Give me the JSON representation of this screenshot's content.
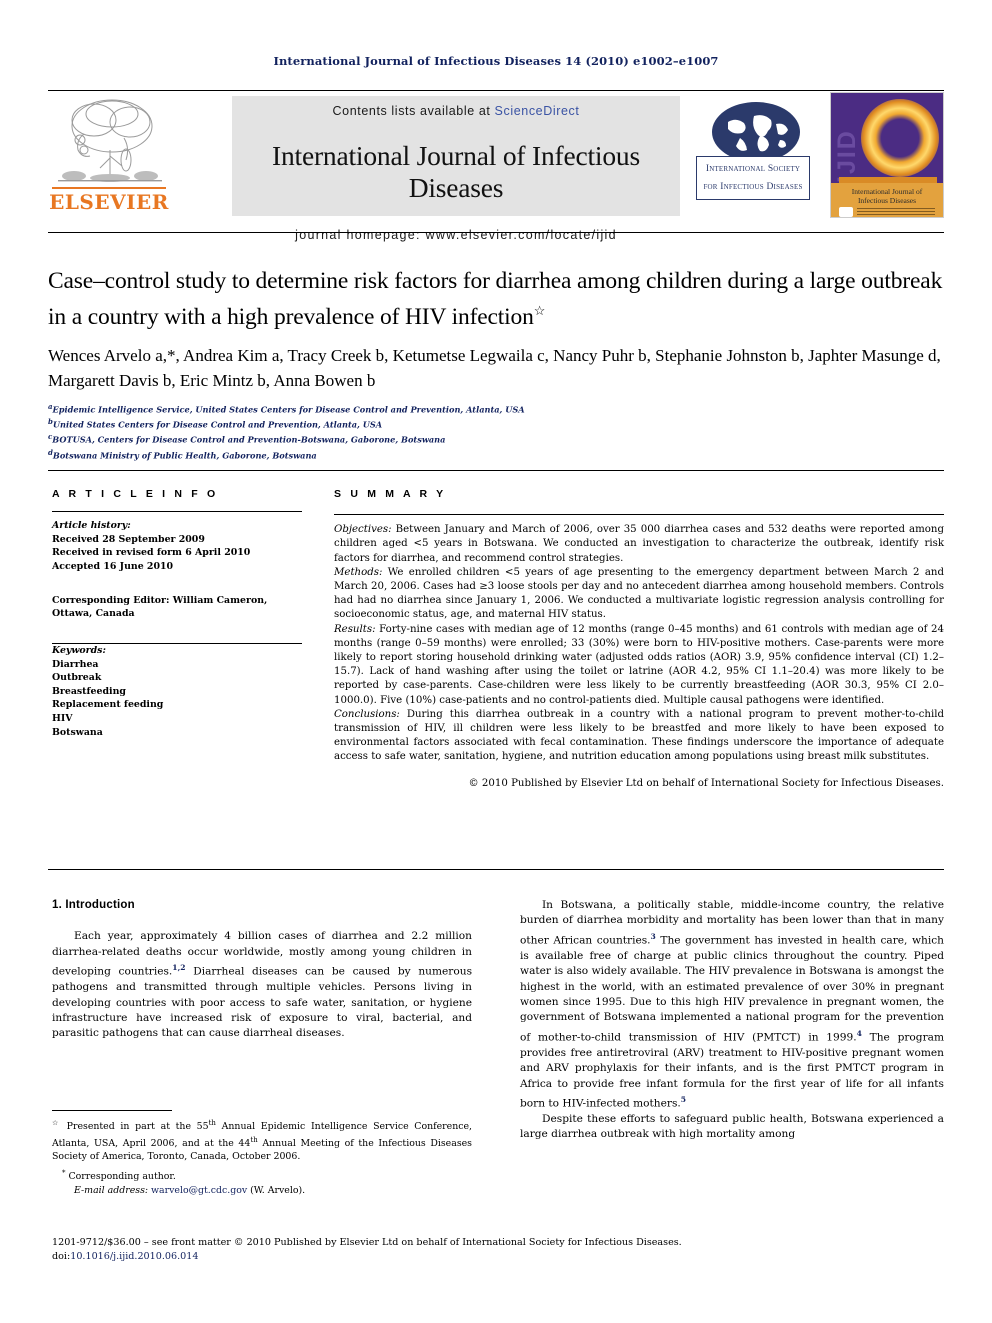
{
  "running_head": "International Journal of Infectious Diseases 14 (2010) e1002–e1007",
  "masthead": {
    "publisher": "ELSEVIER",
    "contents_prefix": "Contents lists available at ",
    "sciencedirect": "ScienceDirect",
    "journal_title": "International Journal of Infectious Diseases",
    "homepage": "journal homepage: www.elsevier.com/locate/ijid",
    "society_line1": "International Society",
    "society_line2": "for Infectious Diseases",
    "cover_abbrev": "IJID",
    "cover_title": "International Journal of Infectious Diseases"
  },
  "article": {
    "title": "Case–control study to determine risk factors for diarrhea among children during a large outbreak in a country with a high prevalence of HIV infection",
    "title_marker": "☆",
    "authors": "Wences Arvelo a,*, Andrea Kim a, Tracy Creek b, Ketumetse Legwaila c, Nancy Puhr b, Stephanie Johnston b, Japhter Masunge d, Margarett Davis b, Eric Mintz b, Anna Bowen b",
    "affiliations": [
      {
        "mark": "a",
        "text": "Epidemic Intelligence Service, United States Centers for Disease Control and Prevention, Atlanta, USA"
      },
      {
        "mark": "b",
        "text": "United States Centers for Disease Control and Prevention, Atlanta, USA"
      },
      {
        "mark": "c",
        "text": "BOTUSA, Centers for Disease Control and Prevention-Botswana, Gaborone, Botswana"
      },
      {
        "mark": "d",
        "text": "Botswana Ministry of Public Health, Gaborone, Botswana"
      }
    ]
  },
  "article_info": {
    "heading": "A R T I C L E  I N F O",
    "history_label": "Article history:",
    "history": [
      "Received 28 September 2009",
      "Received in revised form 6 April 2010",
      "Accepted 16 June 2010"
    ],
    "editor_label": "Corresponding Editor:",
    "editor_value": " William Cameron, Ottawa, Canada",
    "keywords_label": "Keywords:",
    "keywords": [
      "Diarrhea",
      "Outbreak",
      "Breastfeeding",
      "Replacement feeding",
      "HIV",
      "Botswana"
    ]
  },
  "summary": {
    "heading": "S U M M A R Y",
    "objectives_label": "Objectives:",
    "objectives": " Between January and March of 2006, over 35 000 diarrhea cases and 532 deaths were reported among children aged <5 years in Botswana. We conducted an investigation to characterize the outbreak, identify risk factors for diarrhea, and recommend control strategies.",
    "methods_label": "Methods:",
    "methods": " We enrolled children <5 years of age presenting to the emergency department between March 2 and March 20, 2006. Cases had ≥3 loose stools per day and no antecedent diarrhea among household members. Controls had had no diarrhea since January 1, 2006. We conducted a multivariate logistic regression analysis controlling for socioeconomic status, age, and maternal HIV status.",
    "results_label": "Results:",
    "results": " Forty-nine cases with median age of 12 months (range 0–45 months) and 61 controls with median age of 24 months (range 0–59 months) were enrolled; 33 (30%) were born to HIV-positive mothers. Case-parents were more likely to report storing household drinking water (adjusted odds ratios (AOR) 3.9, 95% confidence interval (CI) 1.2–15.7). Lack of hand washing after using the toilet or latrine (AOR 4.2, 95% CI 1.1–20.4) was more likely to be reported by case-parents. Case-children were less likely to be currently breastfeeding (AOR 30.3, 95% CI 2.0–1000.0). Five (10%) case-patients and no control-patients died. Multiple causal pathogens were identified.",
    "conclusions_label": "Conclusions:",
    "conclusions": " During this diarrhea outbreak in a country with a national program to prevent mother-to-child transmission of HIV, ill children were less likely to be breastfed and more likely to have been exposed to environmental factors associated with fecal contamination. These findings underscore the importance of adequate access to safe water, sanitation, hygiene, and nutrition education among populations using breast milk substitutes.",
    "copyright": "© 2010 Published by Elsevier Ltd on behalf of International Society for Infectious Diseases."
  },
  "body": {
    "section_heading": "1. Introduction",
    "left_p1_a": "Each year, approximately 4 billion cases of diarrhea and 2.2 million diarrhea-related deaths occur worldwide, mostly among young children in developing countries.",
    "left_p1_sup": "1,2",
    "left_p1_b": " Diarrheal diseases can be caused by numerous pathogens and transmitted through multiple vehicles. Persons living in developing countries with poor access to safe water, sanitation, or hygiene infrastructure have increased risk of exposure to viral, bacterial, and parasitic pathogens that can cause diarrheal diseases.",
    "right_p1_a": "In Botswana, a politically stable, middle-income country, the relative burden of diarrhea morbidity and mortality has been lower than that in many other African countries.",
    "right_p1_sup1": "3",
    "right_p1_b": " The government has invested in health care, which is available free of charge at public clinics throughout the country. Piped water is also widely available. The HIV prevalence in Botswana is amongst the highest in the world, with an estimated prevalence of over 30% in pregnant women since 1995. Due to this high HIV prevalence in pregnant women, the government of Botswana implemented a national program for the prevention of mother-to-child transmission of HIV (PMTCT) in 1999.",
    "right_p1_sup2": "4",
    "right_p1_c": " The program provides free antiretroviral (ARV) treatment to HIV-positive pregnant women and ARV prophylaxis for their infants, and is the first PMTCT program in Africa to provide free infant formula for the first year of life for all infants born to HIV-infected mothers.",
    "right_p1_sup3": "5",
    "right_p2_a": "Despite these efforts to safeguard public health, Botswana experienced a large diarrhea outbreak with high mortality among"
  },
  "footnotes": {
    "star_a": "Presented in part at the 55",
    "star_sup1": "th",
    "star_b": " Annual Epidemic Intelligence Service Conference, Atlanta, USA, April 2006, and at the 44",
    "star_sup2": "th",
    "star_c": " Annual Meeting of the Infectious Diseases Society of America, Toronto, Canada, October 2006.",
    "corresponding": "Corresponding author.",
    "email_label": "E-mail address:",
    "email": "warvelo@gt.cdc.gov",
    "email_suffix": " (W. Arvelo)."
  },
  "bottom": {
    "front_matter": "1201-9712/$36.00 – see front matter © 2010 Published by Elsevier Ltd on behalf of International Society for Infectious Diseases.",
    "doi_label": "doi:",
    "doi": "10.1016/j.ijid.2010.06.014"
  },
  "colors": {
    "elsevier_orange": "#E87722",
    "link_blue": "#3a53a4",
    "navy": "#12225e",
    "cover_purple": "#4b2c83"
  }
}
